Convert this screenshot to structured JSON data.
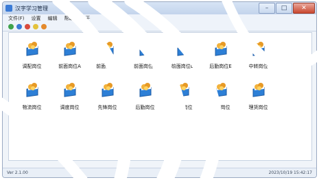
{
  "window": {
    "title": "汉字学习管理"
  },
  "menu": {
    "items": [
      "文件(F)",
      "设置",
      "编辑",
      "帮助",
      "关于"
    ]
  },
  "toolbar": {
    "icons": [
      "green-icon",
      "blue-icon",
      "red-icon",
      "yellow-icon",
      "orange-icon"
    ],
    "colors": [
      "#3fa34d",
      "#3b7bd6",
      "#d94b3d",
      "#e3c23c",
      "#e48a2c"
    ]
  },
  "tiles": [
    {
      "label": "调配岗位"
    },
    {
      "label": "前面岗位A"
    },
    {
      "label": "前面岗位B"
    },
    {
      "label": "前面岗位C"
    },
    {
      "label": "前面岗位D"
    },
    {
      "label": "后勤岗位E"
    },
    {
      "label": "中转岗位"
    },
    {
      "label": "物流岗位"
    },
    {
      "label": "调度岗位"
    },
    {
      "label": "先锋岗位"
    },
    {
      "label": "后勤岗位"
    },
    {
      "label": "特勤岗位"
    },
    {
      "label": "仓储岗位"
    },
    {
      "label": "理货岗位"
    }
  ],
  "status": {
    "left": "Ver 2.1.00",
    "right": "2023/10/19 15:42:17"
  }
}
